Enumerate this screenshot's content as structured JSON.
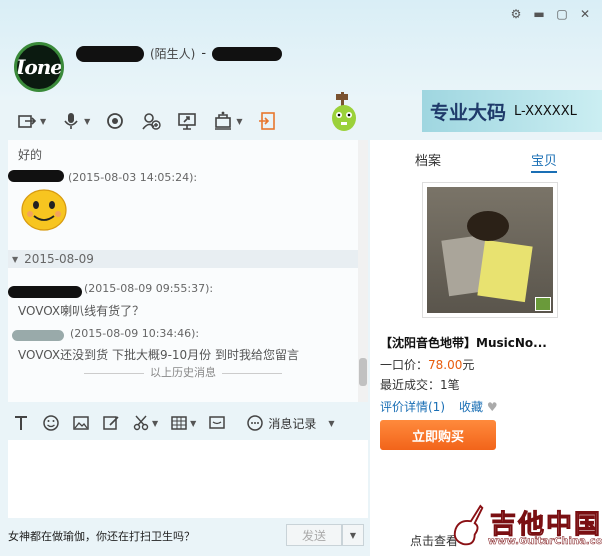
{
  "contact": {
    "stranger_label": "(陌生人)",
    "separator": "-"
  },
  "toolbar": {
    "icons": [
      "file-transfer-icon",
      "microphone-icon",
      "video-call-icon",
      "add-contact-icon",
      "screen-share-icon",
      "remote-desktop-icon",
      "exit-icon"
    ]
  },
  "banner": {
    "big": "专业大码",
    "small": "L-XXXXXL"
  },
  "chat": {
    "msg1_text": "好的",
    "msg2_time": "(2015-08-03 14:05:24):",
    "date_separator": "2015-08-09",
    "msg3_time": "(2015-08-09 09:55:37):",
    "msg3_text": "VOVOX喇叭线有货了？",
    "msg4_time": "(2015-08-09 10:34:46):",
    "msg4_text": "VOVOX还没到货  下批大概9-10月份  到时我给您留言",
    "history_end": "以上历史消息"
  },
  "input_tools": {
    "icons": [
      "font-icon",
      "emoji-icon",
      "image-icon",
      "edit-icon",
      "scissors-icon",
      "table-icon",
      "screenshot-icon"
    ],
    "history_label": "消息记录"
  },
  "footer": {
    "tip": "女神都在做瑜伽，你还在打扫卫生吗？",
    "send_label": "发送"
  },
  "sidebar": {
    "tabs": [
      "档案",
      "宝贝"
    ],
    "active_tab": "宝贝",
    "product_title": "【沈阳音色地带】MusicNo...",
    "price_label": "一口价：",
    "price_value": "78.00",
    "price_unit": "元",
    "sold_label": "最近成交：",
    "sold_value": "1",
    "sold_unit": "笔",
    "review_link": "评价详情(1)",
    "fav_link": "收藏",
    "buy_label": "立即购买",
    "bottom_link": "点击查看"
  },
  "watermark": {
    "big": "吉他中国",
    "small": "www.GuitarChina.com"
  },
  "colors": {
    "accent_blue": "#1a6fb5",
    "price_orange": "#e85c0c",
    "buy_orange": "#f2641a"
  }
}
